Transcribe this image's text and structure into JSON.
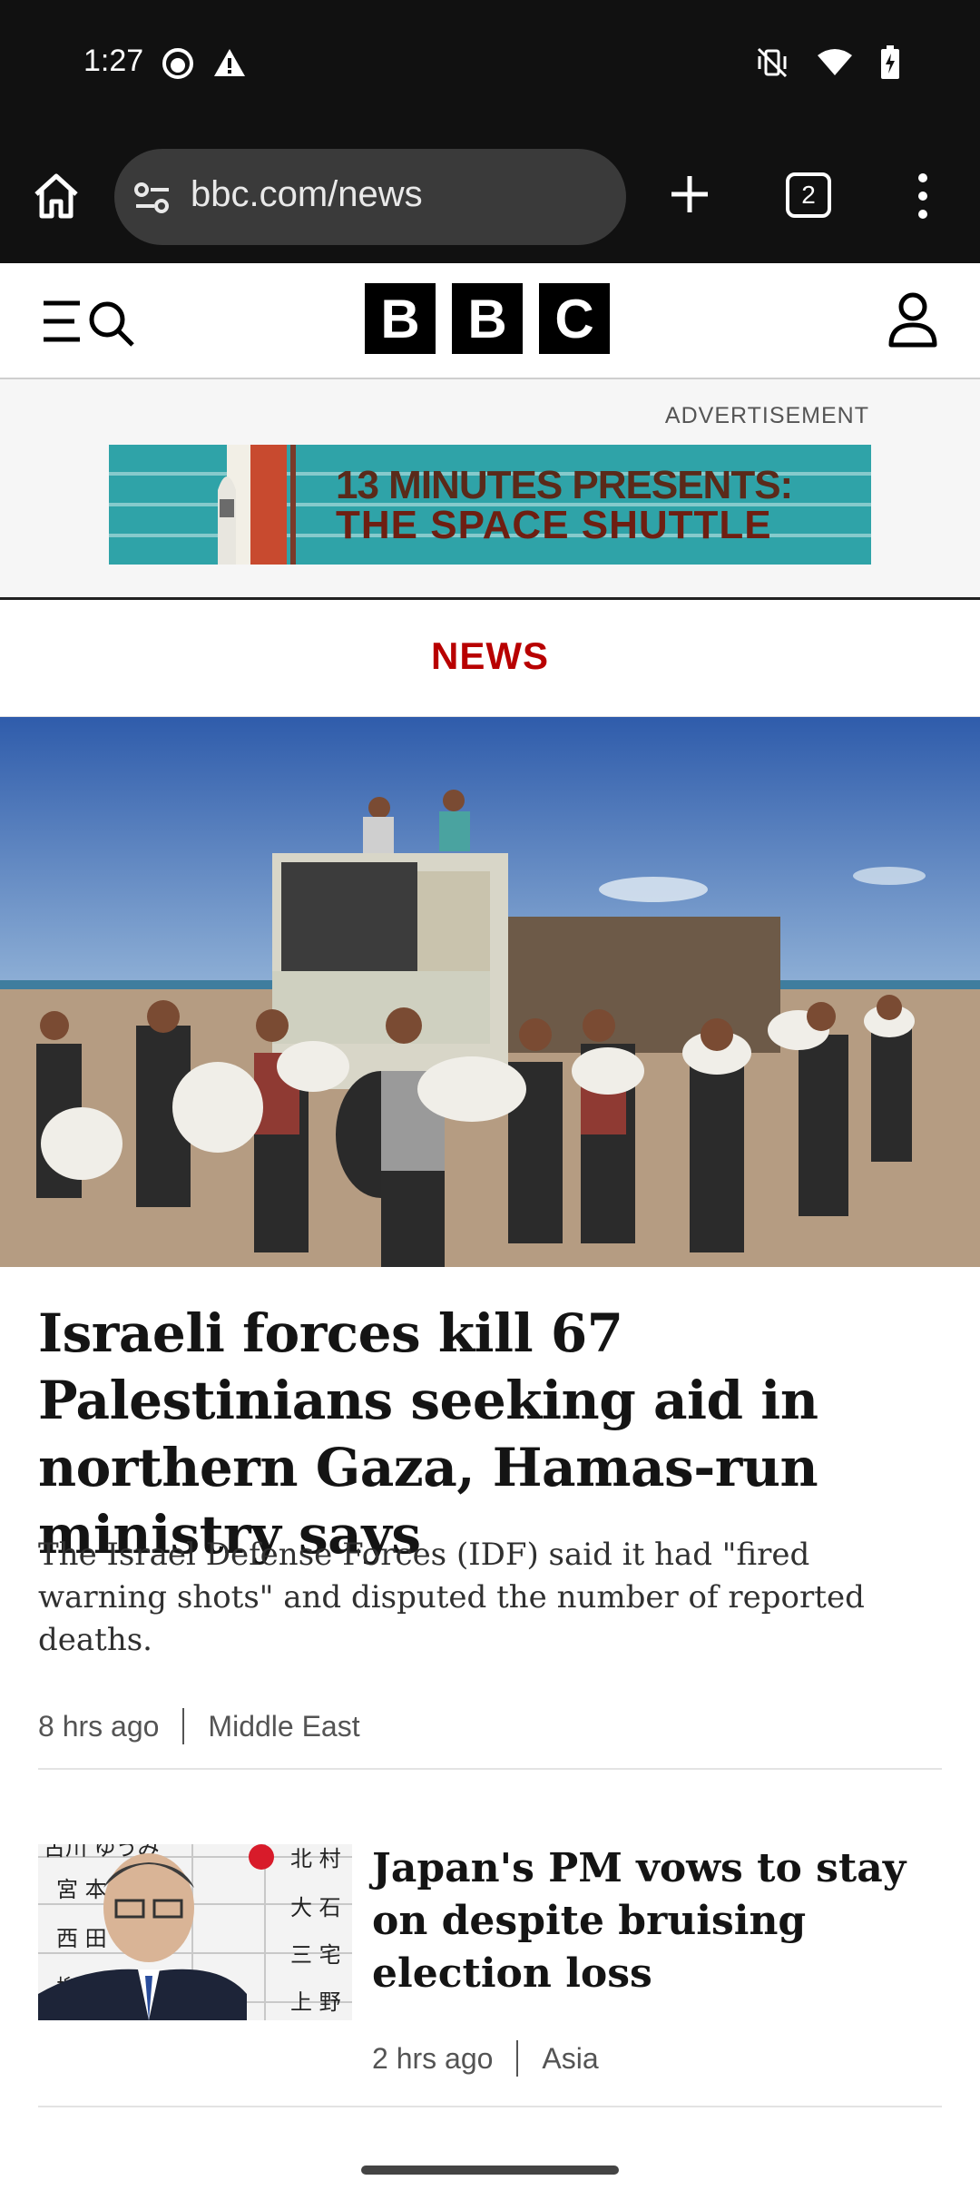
{
  "status_bar": {
    "time": "1:27",
    "icons_left": [
      "face-icon",
      "warning-icon"
    ],
    "icons_right": [
      "mute-vibrate-icon",
      "wifi-icon",
      "battery-charging-icon"
    ]
  },
  "browser": {
    "url": "bbc.com/news",
    "tab_count": "2",
    "icons": [
      "home-icon",
      "site-settings-icon",
      "new-tab-icon",
      "tabs-icon",
      "more-vert-icon"
    ]
  },
  "bbc_header": {
    "logo_letters": [
      "B",
      "B",
      "C"
    ],
    "icons": [
      "menu-search-icon",
      "account-icon"
    ]
  },
  "ad": {
    "label": "ADVERTISEMENT",
    "line1": "13 MINUTES PRESENTS:",
    "line2": "THE SPACE SHUTTLE"
  },
  "section": {
    "title": "NEWS"
  },
  "top_story": {
    "headline": "Israeli forces kill 67 Palestinians seeking aid in northern Gaza, Hamas-run ministry says",
    "summary": "The Israel Defense Forces (IDF) said it had \"fired warning shots\" and disputed the number of reported deaths.",
    "time": "8 hrs ago",
    "topic": "Middle East"
  },
  "story2": {
    "headline": "Japan's PM vows to stay on despite bruising election loss",
    "time": "2 hrs ago",
    "topic": "Asia",
    "board_names": [
      "古川 ゆうみ",
      "宮 本",
      "西 田",
      "柳",
      "北 村",
      "大 石",
      "三 宅",
      "上 野"
    ]
  },
  "colors": {
    "bbc_red": "#b80000",
    "chrome_bg": "#111111",
    "urlbar_bg": "#3a3a3a"
  }
}
